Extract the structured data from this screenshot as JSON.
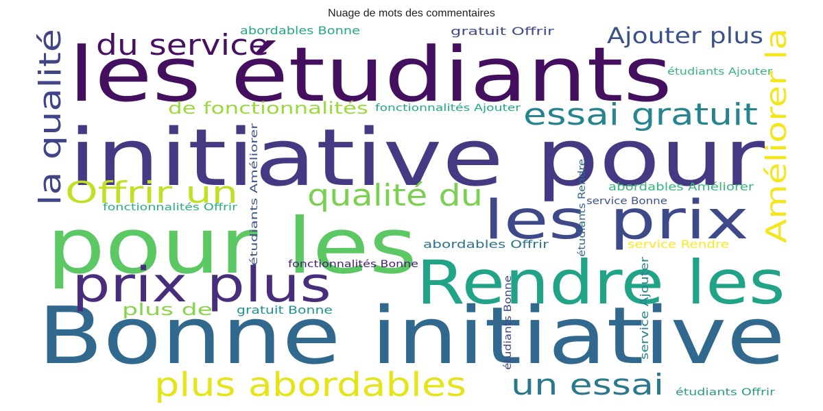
{
  "chart_data": {
    "type": "wordcloud",
    "title": "Nuage de mots des commentaires",
    "background": "#ffffff",
    "colormap": "viridis",
    "words": [
      {
        "text": "les étudiants",
        "color": "#440f5e"
      },
      {
        "text": "initiative pour",
        "color": "#443a83"
      },
      {
        "text": "pour les",
        "color": "#5cc863"
      },
      {
        "text": "Bonne initiative",
        "color": "#31688e"
      },
      {
        "text": "Rendre les",
        "color": "#20a386"
      },
      {
        "text": "les prix",
        "color": "#3e4989"
      },
      {
        "text": "prix plus",
        "color": "#472d7b"
      },
      {
        "text": "plus abordables",
        "color": "#e5e419"
      },
      {
        "text": "la qualité",
        "color": "#404588"
      },
      {
        "text": "Améliorer la",
        "color": "#f3e51e"
      },
      {
        "text": "essai gratuit",
        "color": "#25848e"
      },
      {
        "text": "qualité du",
        "color": "#7ad151"
      },
      {
        "text": "Offrir un",
        "color": "#c2df23"
      },
      {
        "text": "du service",
        "color": "#471063"
      },
      {
        "text": "Ajouter plus",
        "color": "#3b518b"
      },
      {
        "text": "un essai",
        "color": "#2a788e"
      },
      {
        "text": "de fonctionnalités",
        "color": "#9bd93c"
      },
      {
        "text": "plus de",
        "color": "#86d549"
      },
      {
        "text": "abordables Bonne",
        "color": "#22a785"
      },
      {
        "text": "gratuit Offrir",
        "color": "#3e4989"
      },
      {
        "text": "étudiants Ajouter",
        "color": "#35b779"
      },
      {
        "text": "fonctionnalités Ajouter",
        "color": "#22a884"
      },
      {
        "text": "étudiants Améliorer",
        "color": "#3b528b"
      },
      {
        "text": "fonctionnalités Offrir",
        "color": "#29af7f"
      },
      {
        "text": "abordables Améliorer",
        "color": "#35b779"
      },
      {
        "text": "service Bonne",
        "color": "#3b528b"
      },
      {
        "text": "étudiants Rendre",
        "color": "#31688e"
      },
      {
        "text": "abordables Offrir",
        "color": "#2c728e"
      },
      {
        "text": "service Rendre",
        "color": "#fde725"
      },
      {
        "text": "étudiants Bonne",
        "color": "#3f4788"
      },
      {
        "text": "fonctionnalités Bonne",
        "color": "#482173"
      },
      {
        "text": "gratuit Bonne",
        "color": "#21908d"
      },
      {
        "text": "service Ajouter",
        "color": "#26828e"
      },
      {
        "text": "étudiants Offrir",
        "color": "#2a9b8a"
      }
    ]
  }
}
